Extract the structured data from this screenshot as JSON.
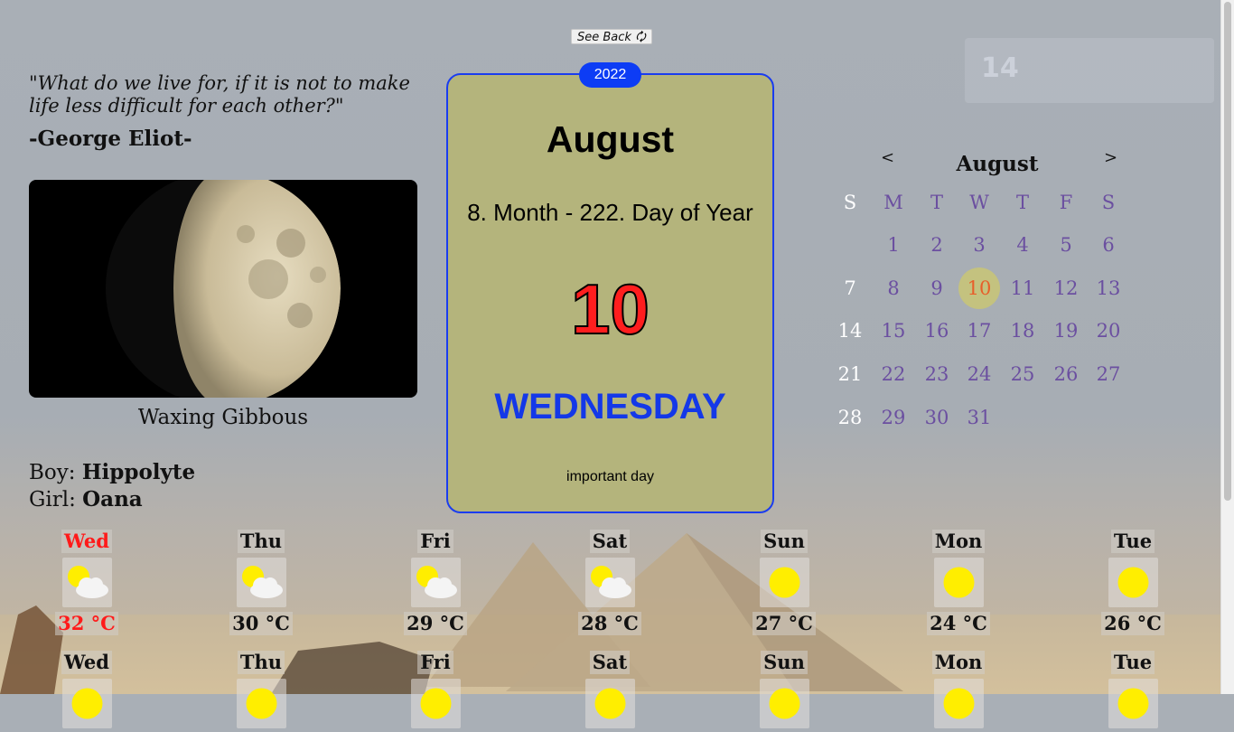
{
  "toolbar": {
    "see_back_label": "See Back 🗘"
  },
  "quote": {
    "text": "\"What do we live for, if it is not to make life less difficult for each other?\"",
    "author": "-George Eliot-"
  },
  "moon": {
    "phase_label": "Waxing Gibbous"
  },
  "names": {
    "boy_prefix": "Boy: ",
    "boy_name": "Hippolyte",
    "girl_prefix": "Girl: ",
    "girl_name": "Oana"
  },
  "date_card": {
    "year": "2022",
    "month": "August",
    "day_of_year_text": "8. Month - 222. Day of Year",
    "day": "10",
    "weekday": "WEDNESDAY",
    "note": "important day",
    "colors": {
      "badge": "#0d3cf5",
      "border": "#1a3cf0",
      "day": "#ff1e1e",
      "weekday": "#1438e8"
    }
  },
  "calendar": {
    "prev_label": "<",
    "next_label": ">",
    "month": "August",
    "weekday_headers": [
      "S",
      "M",
      "T",
      "W",
      "T",
      "F",
      "S"
    ],
    "weeks": [
      [
        "",
        "1",
        "2",
        "3",
        "4",
        "5",
        "6"
      ],
      [
        "7",
        "8",
        "9",
        "10",
        "11",
        "12",
        "13"
      ],
      [
        "14",
        "15",
        "16",
        "17",
        "18",
        "19",
        "20"
      ],
      [
        "21",
        "22",
        "23",
        "24",
        "25",
        "26",
        "27"
      ],
      [
        "28",
        "29",
        "30",
        "31",
        "",
        "",
        ""
      ]
    ],
    "today": "10"
  },
  "forecast": {
    "days": [
      {
        "day": "Wed",
        "icon": "partly-cloudy-icon",
        "temp": "32 °C",
        "today": true
      },
      {
        "day": "Thu",
        "icon": "partly-cloudy-icon",
        "temp": "30 °C",
        "today": false
      },
      {
        "day": "Fri",
        "icon": "partly-cloudy-icon",
        "temp": "29 °C",
        "today": false
      },
      {
        "day": "Sat",
        "icon": "partly-cloudy-icon",
        "temp": "28 °C",
        "today": false
      },
      {
        "day": "Sun",
        "icon": "sun-icon",
        "temp": "27 °C",
        "today": false
      },
      {
        "day": "Mon",
        "icon": "sun-icon",
        "temp": "24 °C",
        "today": false
      },
      {
        "day": "Tue",
        "icon": "sun-icon",
        "temp": "26 °C",
        "today": false
      }
    ],
    "second_row": [
      {
        "day": "Wed",
        "icon": "sun-icon"
      },
      {
        "day": "Thu",
        "icon": "sun-icon"
      },
      {
        "day": "Fri",
        "icon": "sun-icon"
      },
      {
        "day": "Sat",
        "icon": "sun-icon"
      },
      {
        "day": "Sun",
        "icon": "sun-icon"
      },
      {
        "day": "Mon",
        "icon": "sun-icon"
      },
      {
        "day": "Tue",
        "icon": "sun-icon"
      }
    ]
  }
}
